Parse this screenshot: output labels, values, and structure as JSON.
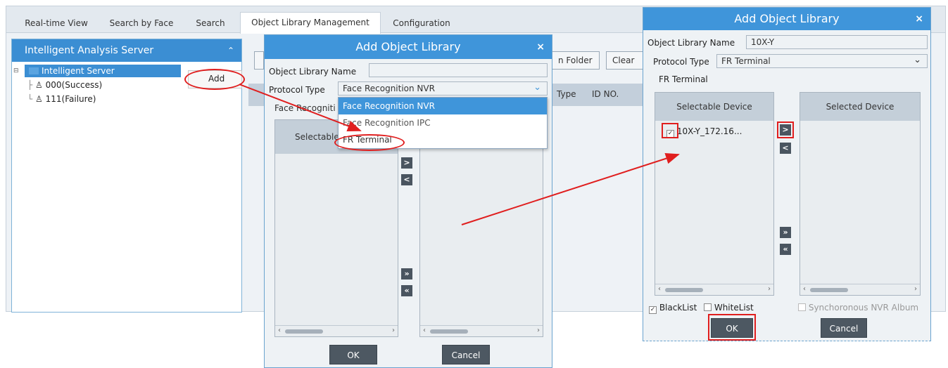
{
  "tabs": [
    "Real-time View",
    "Search by Face",
    "Search",
    "Object Library Management",
    "Configuration"
  ],
  "left_panel": {
    "title": "Intelligent Analysis Server",
    "root": "Intelligent Server",
    "items": [
      "000(Success)",
      "111(Failure)"
    ],
    "context_menu": "Add"
  },
  "toolbar": {
    "open_folder_partial": "n Folder",
    "clear_partial": "Clear A"
  },
  "grid_columns": {
    "type_partial": "Type",
    "id": "ID NO."
  },
  "dialog1": {
    "title": "Add Object Library",
    "name_label": "Object Library Name",
    "name_value": "",
    "protocol_label": "Protocol Type",
    "protocol_value": "Face Recognition NVR",
    "options": [
      "Face Recognition NVR",
      "Face Recognition IPC",
      "FR Terminal"
    ],
    "group_partial": "Face Recogniti",
    "selectable_partial": "Selectable",
    "ok": "OK",
    "cancel": "Cancel"
  },
  "dialog2": {
    "title": "Add Object Library",
    "name_label": "Object Library Name",
    "name_value": "10X-Y",
    "protocol_label": "Protocol Type",
    "protocol_value": "FR Terminal",
    "group": "FR Terminal",
    "selectable_header": "Selectable Device",
    "selected_header": "Selected Device",
    "device": "10X-Y_172.16...",
    "blacklist": "BlackList",
    "whitelist": "WhiteList",
    "sync": "Synchoronous NVR Album",
    "ok": "OK",
    "cancel": "Cancel"
  },
  "colors": {
    "accent": "#3f95da",
    "annotation": "#e01e1e"
  }
}
